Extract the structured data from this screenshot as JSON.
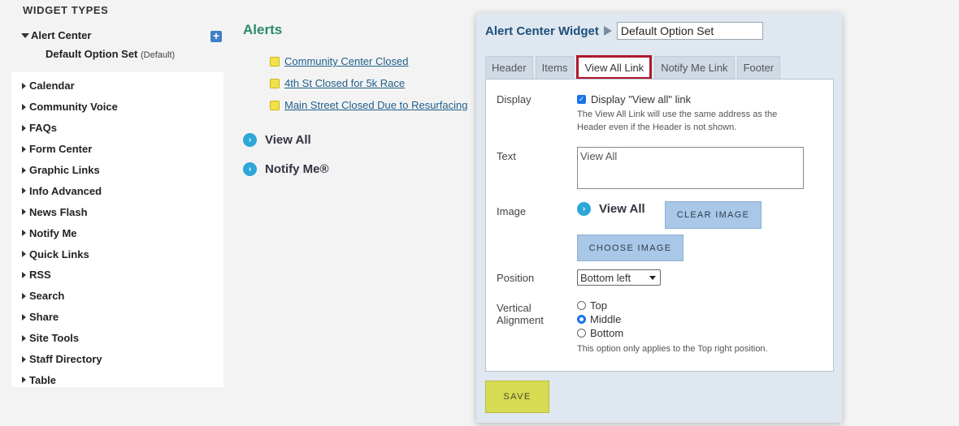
{
  "sidebar": {
    "heading": "WIDGET TYPES",
    "expanded": {
      "label": "Alert Center",
      "add_icon": "plus-icon",
      "option_set": "Default Option Set",
      "option_set_tag": "(Default)"
    },
    "items": [
      {
        "label": "Calendar"
      },
      {
        "label": "Community Voice"
      },
      {
        "label": "FAQs"
      },
      {
        "label": "Form Center"
      },
      {
        "label": "Graphic Links"
      },
      {
        "label": "Info Advanced"
      },
      {
        "label": "News Flash"
      },
      {
        "label": "Notify Me"
      },
      {
        "label": "Quick Links"
      },
      {
        "label": "RSS"
      },
      {
        "label": "Search"
      },
      {
        "label": "Share"
      },
      {
        "label": "Site Tools"
      },
      {
        "label": "Staff Directory"
      },
      {
        "label": "Table"
      }
    ]
  },
  "preview": {
    "title": "Alerts",
    "alerts": [
      {
        "label": "Community Center Closed"
      },
      {
        "label": "4th St Closed for 5k Race"
      },
      {
        "label": "Main Street Closed Due to Resurfacing"
      }
    ],
    "view_all": "View All",
    "notify_me": "Notify Me®"
  },
  "modal": {
    "title": "Alert Center Widget",
    "option_set_name": "Default Option Set",
    "tabs": [
      {
        "label": "Header"
      },
      {
        "label": "Items"
      },
      {
        "label": "View All Link",
        "active": true
      },
      {
        "label": "Notify Me Link"
      },
      {
        "label": "Footer"
      }
    ],
    "display": {
      "label": "Display",
      "checkbox_label": "Display \"View all\" link",
      "checked": true,
      "help": "The View All Link will use the same address as the Header even if the Header is not shown."
    },
    "text": {
      "label": "Text",
      "value": "View All"
    },
    "image": {
      "label": "Image",
      "preview_text": "View All",
      "clear_button": "CLEAR IMAGE",
      "choose_button": "CHOOSE IMAGE"
    },
    "position": {
      "label": "Position",
      "selected": "Bottom left"
    },
    "vertical_alignment": {
      "label_line1": "Vertical",
      "label_line2": "Alignment",
      "options": [
        {
          "label": "Top",
          "checked": false
        },
        {
          "label": "Middle",
          "checked": true
        },
        {
          "label": "Bottom",
          "checked": false
        }
      ],
      "help": "This option only applies to the Top right position."
    },
    "save_button": "SAVE"
  },
  "colors": {
    "accent_green": "#2a8a6e",
    "link_blue": "#1f5f8b",
    "active_tab_border": "#b0182c",
    "save_yellow": "#d7db52"
  }
}
